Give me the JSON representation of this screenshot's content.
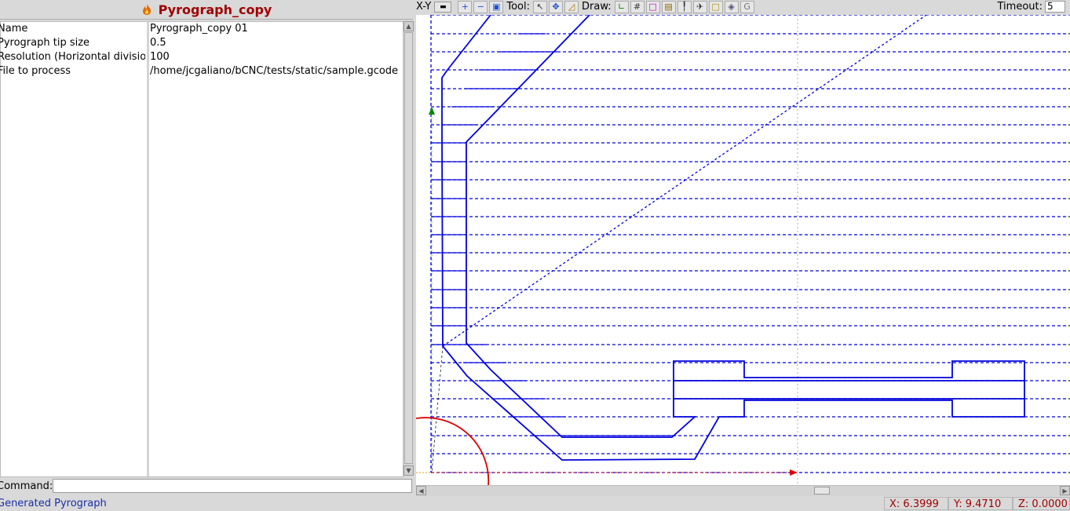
{
  "panel": {
    "title": "Pyrograph_copy",
    "icon": "flame-icon",
    "properties": [
      {
        "name": "Name",
        "value": "Pyrograph_copy 01"
      },
      {
        "name": "Pyrograph tip size",
        "value": "0.5"
      },
      {
        "name": "Resolution (Horizontal divisio",
        "value": "100"
      },
      {
        "name": "File to process",
        "value": "/home/jcgaliano/bCNC/tests/static/sample.gcode"
      }
    ]
  },
  "command": {
    "label": "Command:",
    "value": ""
  },
  "status": {
    "message": "Generated Pyrograph"
  },
  "toolbar": {
    "view": "X-Y",
    "tool_label": "Tool:",
    "draw_label": "Draw:",
    "timeout_label": "Timeout:",
    "timeout_value": "5",
    "zoom_in_icon": "zoom-in-icon",
    "zoom_out_icon": "zoom-out-icon",
    "zoom_fit_icon": "zoom-fit-icon",
    "select_icon": "pointer-icon",
    "pan_icon": "pan-icon",
    "ruler_icon": "ruler-icon",
    "draw_icons": [
      "axes-icon",
      "grid-icon",
      "margins-icon",
      "workarea-icon",
      "probe-icon",
      "rapid-icon",
      "paths-icon",
      "camera-icon",
      "gantry-icon"
    ]
  },
  "coords": {
    "x": "X: 6.3999",
    "y": "Y: 9.4710",
    "z": "Z: 0.0000"
  },
  "colors": {
    "path": "#0000dd",
    "title": "#a00000",
    "origin_arc": "#dd0000",
    "status_text": "#1a2fa8"
  }
}
